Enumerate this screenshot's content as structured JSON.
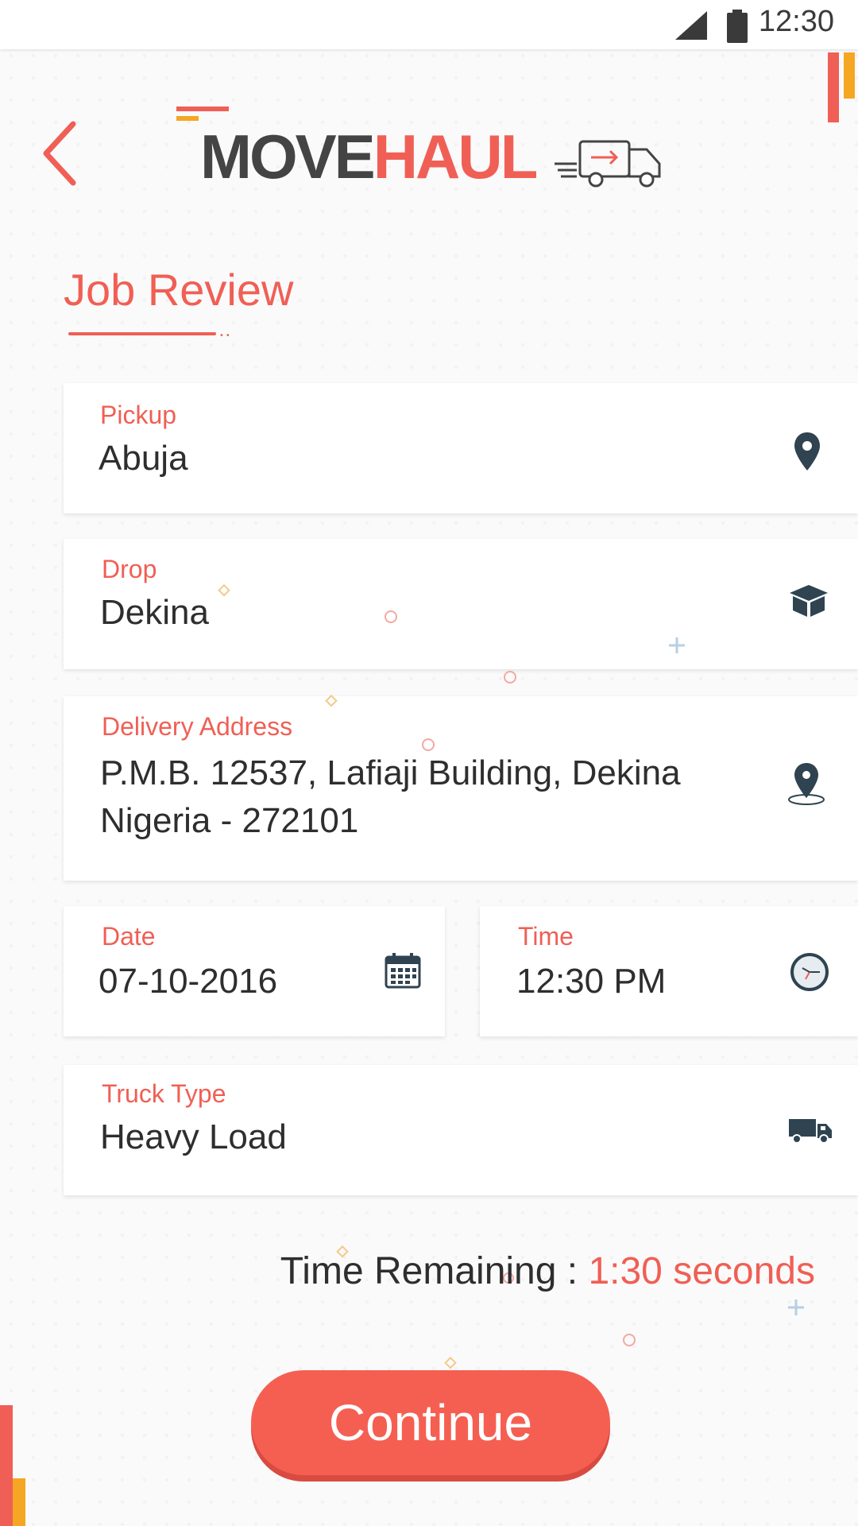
{
  "status_bar": {
    "time": "12:30",
    "signal_icon": "signal-icon",
    "battery_icon": "battery-icon"
  },
  "header": {
    "back_icon": "chevron-left-icon",
    "logo": {
      "part1": "MOVE",
      "part2": "HAUL",
      "icon": "truck-icon"
    }
  },
  "page": {
    "title": "Job Review"
  },
  "fields": {
    "pickup": {
      "label": "Pickup",
      "value": "Abuja",
      "icon": "location-pin-icon"
    },
    "drop": {
      "label": "Drop",
      "value": "Dekina",
      "icon": "box-icon"
    },
    "delivery_address": {
      "label": "Delivery Address",
      "line1": "P.M.B. 12537, Lafiaji Building, Dekina",
      "line2": "Nigeria - 272101",
      "icon": "map-pin-icon"
    },
    "date": {
      "label": "Date",
      "value": "07-10-2016",
      "icon": "calendar-icon"
    },
    "time": {
      "label": "Time",
      "value": "12:30 PM",
      "icon": "clock-icon"
    },
    "truck_type": {
      "label": "Truck Type",
      "value": "Heavy Load",
      "icon": "truck-icon"
    }
  },
  "timer": {
    "label": "Time Remaining :",
    "value": "1:30 seconds"
  },
  "actions": {
    "continue_label": "Continue"
  },
  "colors": {
    "accent": "#f05f55",
    "accent_yellow": "#f5a623",
    "icon_dark": "#2f4350"
  }
}
